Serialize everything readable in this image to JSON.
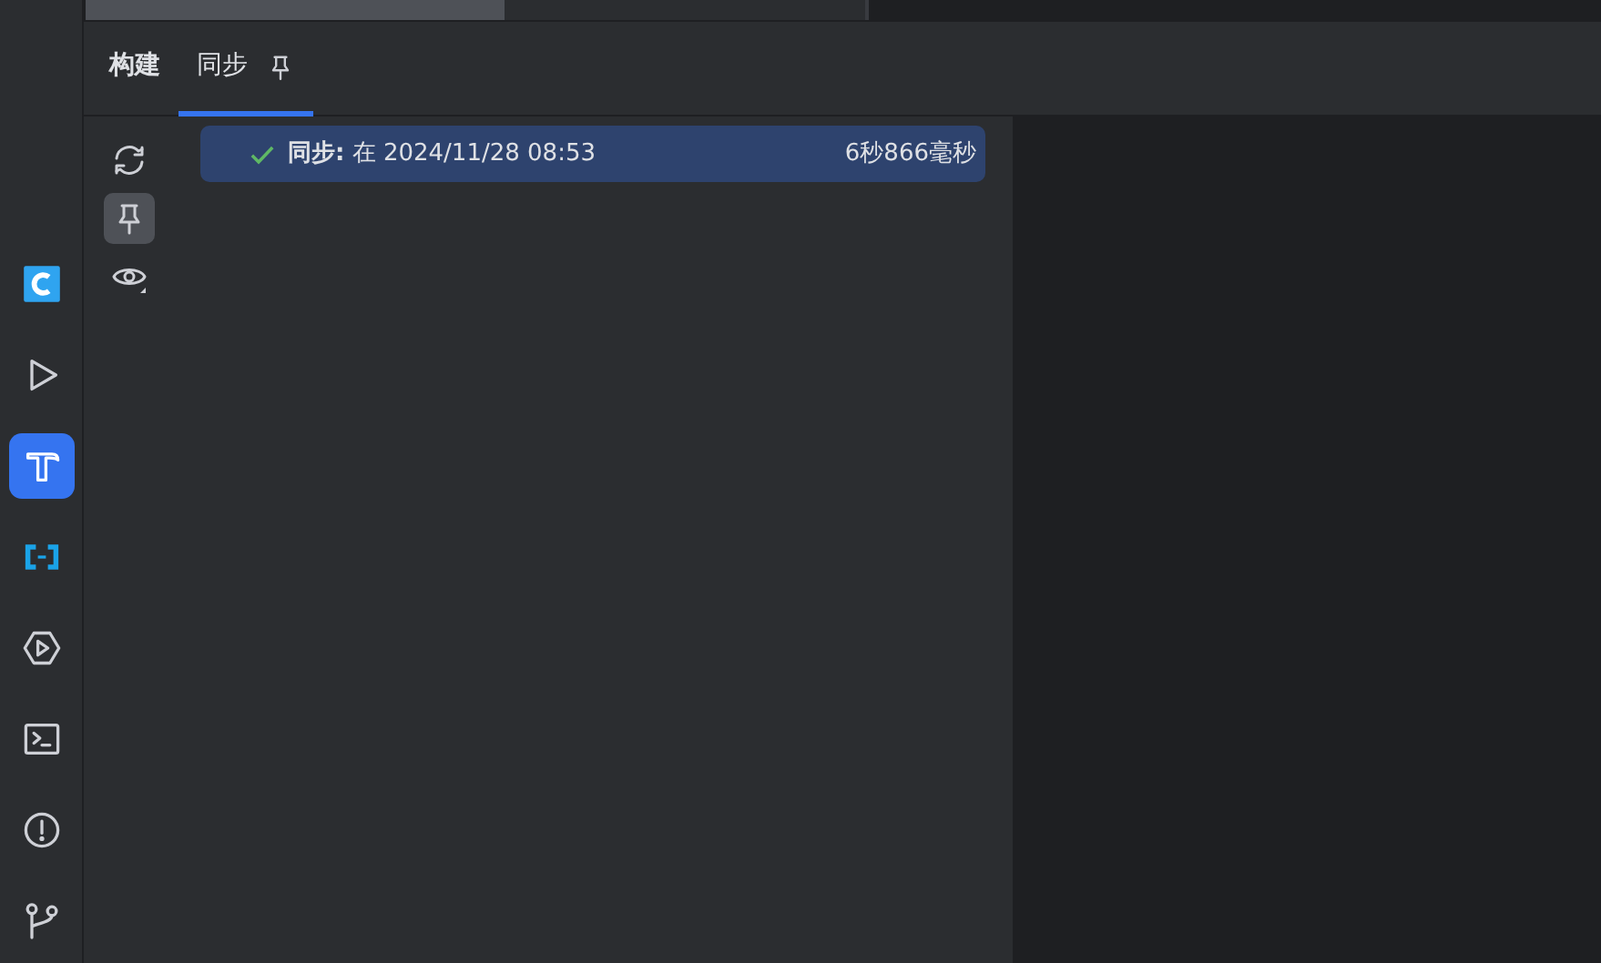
{
  "tool_strip": [
    {
      "kind": "app",
      "selected": false
    },
    {
      "kind": "run",
      "selected": false
    },
    {
      "kind": "build",
      "selected": true
    },
    {
      "kind": "cloud",
      "selected": false
    },
    {
      "kind": "services",
      "selected": false
    },
    {
      "kind": "terminal",
      "selected": false
    },
    {
      "kind": "problems",
      "selected": false
    },
    {
      "kind": "git",
      "selected": false
    }
  ],
  "tabs": [
    {
      "label": "构建",
      "selected": false,
      "pinned": false
    },
    {
      "label": "同步",
      "selected": true,
      "pinned": true
    }
  ],
  "toolbar": [
    {
      "kind": "sync",
      "selected": false
    },
    {
      "kind": "pin",
      "selected": true
    },
    {
      "kind": "eye",
      "selected": false
    }
  ],
  "tree": [
    {
      "kind": "success",
      "title": "同步:",
      "text": "在 2024/11/28 08:53",
      "duration": "6秒866毫秒",
      "selected": true
    }
  ]
}
